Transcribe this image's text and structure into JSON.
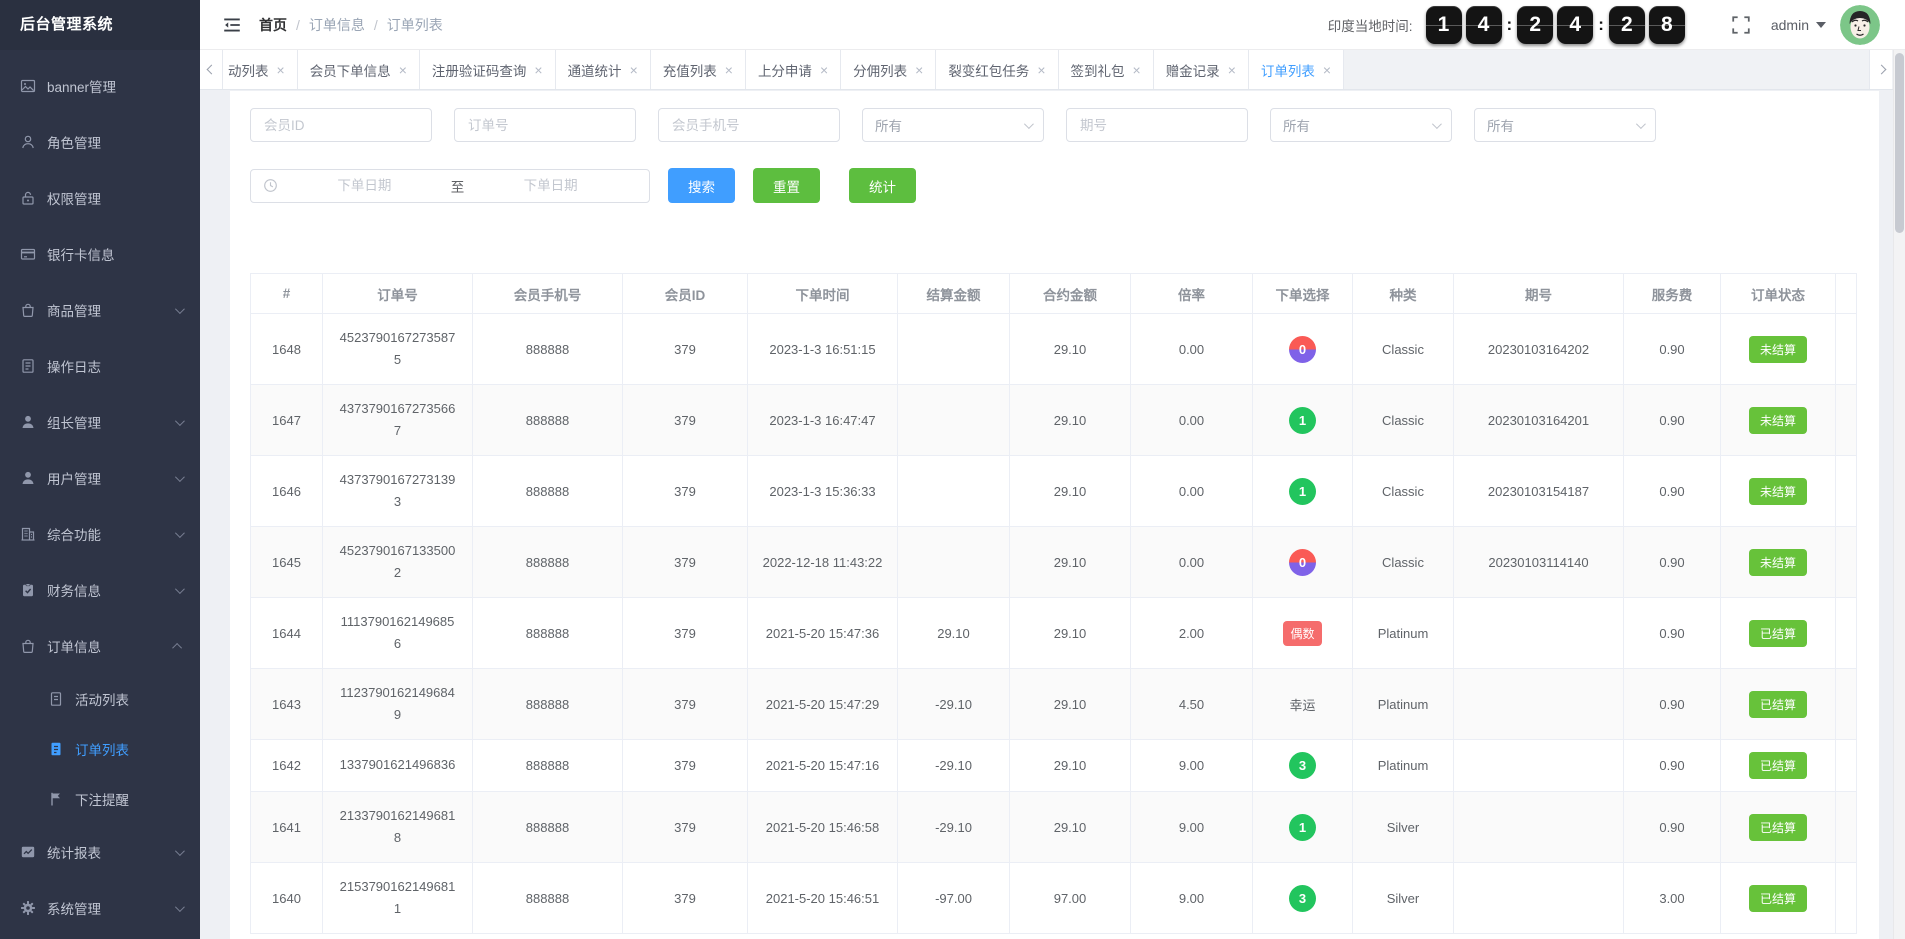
{
  "app": {
    "title": "后台管理系统"
  },
  "colors": {
    "accent": "#409EFF",
    "success": "#67C23A",
    "danger": "#F56C6C",
    "sidebar_bg": "#2E3446",
    "circle_green": "#22C55E",
    "circle_red": "#FA5A55",
    "circle_purple": "#7F62E8",
    "button_green": "#5DBE3F"
  },
  "sidebar": {
    "items": [
      {
        "label": "banner管理"
      },
      {
        "label": "角色管理"
      },
      {
        "label": "权限管理"
      },
      {
        "label": "银行卡信息"
      },
      {
        "label": "商品管理"
      },
      {
        "label": "操作日志"
      },
      {
        "label": "组长管理"
      },
      {
        "label": "用户管理"
      },
      {
        "label": "综合功能"
      },
      {
        "label": "财务信息"
      },
      {
        "label": "订单信息",
        "children": [
          "活动列表",
          "订单列表",
          "下注提醒"
        ],
        "active_child": "订单列表"
      },
      {
        "label": "统计报表"
      },
      {
        "label": "系统管理"
      }
    ]
  },
  "header": {
    "breadcrumb": {
      "home": "首页",
      "separator": "/",
      "section": "订单信息",
      "page": "订单列表"
    },
    "clock": {
      "label": "印度当地时间:",
      "digits": [
        "1",
        "4",
        "2",
        "4",
        "2",
        "8"
      ],
      "separator": ":"
    },
    "user": {
      "name": "admin"
    }
  },
  "tabs": {
    "close_glyph": "×",
    "active": "订单列表",
    "items": [
      "动列表",
      "会员下单信息",
      "注册验证码查询",
      "通道统计",
      "充值列表",
      "上分申请",
      "分佣列表",
      "裂变红包任务",
      "签到礼包",
      "赠金记录",
      "订单列表"
    ]
  },
  "filters": {
    "member_id_ph": "会员ID",
    "order_no_ph": "订单号",
    "phone_ph": "会员手机号",
    "issue_ph": "期号",
    "selects": [
      "所有",
      "所有",
      "所有"
    ],
    "date_start_ph": "下单日期",
    "date_separator": "至",
    "date_end_ph": "下单日期",
    "search_label": "搜索",
    "reset_label": "重置",
    "stats_label": "统计"
  },
  "table": {
    "headers": [
      "#",
      "订单号",
      "会员手机号",
      "会员ID",
      "下单时间",
      "结算金额",
      "合约金额",
      "倍率",
      "下单选择",
      "种类",
      "期号",
      "服务费",
      "订单状态"
    ],
    "rows": [
      {
        "id": "1648",
        "order": "45237901672735875",
        "phone": "888888",
        "uid": "379",
        "time": "2023-1-3 16:51:15",
        "settle": "",
        "amount": "29.10",
        "rate": "0.00",
        "choice": "0",
        "choice_type": "circle-red-purple",
        "kind": "Classic",
        "issue": "20230103164202",
        "fee": "0.90",
        "status": "未结算"
      },
      {
        "id": "1647",
        "order": "43737901672735667",
        "phone": "888888",
        "uid": "379",
        "time": "2023-1-3 16:47:47",
        "settle": "",
        "amount": "29.10",
        "rate": "0.00",
        "choice": "1",
        "choice_type": "circle-green",
        "kind": "Classic",
        "issue": "20230103164201",
        "fee": "0.90",
        "status": "未结算"
      },
      {
        "id": "1646",
        "order": "43737901672731393",
        "phone": "888888",
        "uid": "379",
        "time": "2023-1-3 15:36:33",
        "settle": "",
        "amount": "29.10",
        "rate": "0.00",
        "choice": "1",
        "choice_type": "circle-green",
        "kind": "Classic",
        "issue": "20230103154187",
        "fee": "0.90",
        "status": "未结算"
      },
      {
        "id": "1645",
        "order": "45237901671335002",
        "phone": "888888",
        "uid": "379",
        "time": "2022-12-18 11:43:22",
        "settle": "",
        "amount": "29.10",
        "rate": "0.00",
        "choice": "0",
        "choice_type": "circle-red-purple",
        "kind": "Classic",
        "issue": "20230103114140",
        "fee": "0.90",
        "status": "未结算"
      },
      {
        "id": "1644",
        "order": "11137901621496856",
        "phone": "888888",
        "uid": "379",
        "time": "2021-5-20 15:47:36",
        "settle": "29.10",
        "amount": "29.10",
        "rate": "2.00",
        "choice": "偶数",
        "choice_type": "tag-red",
        "kind": "Platinum",
        "issue": "",
        "fee": "0.90",
        "status": "已结算"
      },
      {
        "id": "1643",
        "order": "11237901621496849",
        "phone": "888888",
        "uid": "379",
        "time": "2021-5-20 15:47:29",
        "settle": "-29.10",
        "amount": "29.10",
        "rate": "4.50",
        "choice": "幸运",
        "choice_type": "text",
        "kind": "Platinum",
        "issue": "",
        "fee": "0.90",
        "status": "已结算"
      },
      {
        "id": "1642",
        "order": "1337901621496836",
        "phone": "888888",
        "uid": "379",
        "time": "2021-5-20 15:47:16",
        "settle": "-29.10",
        "amount": "29.10",
        "rate": "9.00",
        "choice": "3",
        "choice_type": "circle-green",
        "kind": "Platinum",
        "issue": "",
        "fee": "0.90",
        "status": "已结算"
      },
      {
        "id": "1641",
        "order": "21337901621496818",
        "phone": "888888",
        "uid": "379",
        "time": "2021-5-20 15:46:58",
        "settle": "-29.10",
        "amount": "29.10",
        "rate": "9.00",
        "choice": "1",
        "choice_type": "circle-green",
        "kind": "Silver",
        "issue": "",
        "fee": "0.90",
        "status": "已结算"
      },
      {
        "id": "1640",
        "order": "21537901621496811",
        "phone": "888888",
        "uid": "379",
        "time": "2021-5-20 15:46:51",
        "settle": "-97.00",
        "amount": "97.00",
        "rate": "9.00",
        "choice": "3",
        "choice_type": "circle-green",
        "kind": "Silver",
        "issue": "",
        "fee": "3.00",
        "status": "已结算"
      }
    ]
  }
}
